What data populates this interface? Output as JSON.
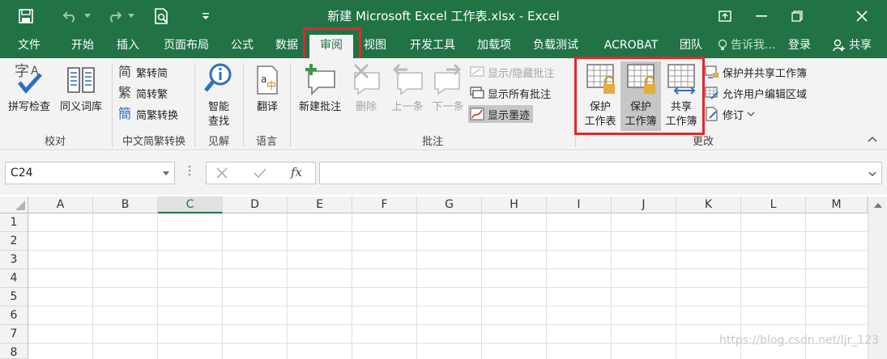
{
  "window": {
    "title": "新建 Microsoft Excel 工作表.xlsx - Excel"
  },
  "tabs": [
    "文件",
    "开始",
    "插入",
    "页面布局",
    "公式",
    "数据",
    "审阅",
    "视图",
    "开发工具",
    "加载项",
    "负载测试",
    "ACROBAT",
    "团队"
  ],
  "active_tab": "审阅",
  "tell_me": "告诉我...",
  "login": "登录",
  "share": "共享",
  "ribbon": {
    "spell_check": "拼写检查",
    "thesaurus": "同义词库",
    "to_traditional": "繁转简",
    "to_simplified": "简转繁",
    "convert": "简繁转换",
    "smart_lookup_1": "智能",
    "smart_lookup_2": "查找",
    "translate": "翻译",
    "new_comment": "新建批注",
    "delete": "删除",
    "previous": "上一条",
    "next": "下一条",
    "show_hide_comment": "显示/隐藏批注",
    "show_all_comments": "显示所有批注",
    "show_ink": "显示墨迹",
    "protect_sheet_1": "保护",
    "protect_sheet_2": "工作表",
    "protect_workbook_1": "保护",
    "protect_workbook_2": "工作簿",
    "share_workbook_1": "共享",
    "share_workbook_2": "工作簿",
    "protect_share": "保护并共享工作簿",
    "allow_edit_ranges": "允许用户编辑区域",
    "track_changes": "修订",
    "groups": {
      "proofing": "校对",
      "chinese": "中文简繁转换",
      "insights": "见解",
      "language": "语言",
      "comments": "批注",
      "changes": "更改"
    }
  },
  "namebox": "C24",
  "fx_label": "fx",
  "columns": [
    "A",
    "B",
    "C",
    "D",
    "E",
    "F",
    "G",
    "H",
    "I",
    "J",
    "K",
    "L",
    "M"
  ],
  "selected_column": "C",
  "rows": [
    "1",
    "2",
    "3",
    "4",
    "5",
    "6",
    "7",
    "8"
  ],
  "watermark": "https://blog.csdn.net/ljr_123",
  "colors": {
    "accent": "#217346",
    "highlight": "#e5262c"
  }
}
